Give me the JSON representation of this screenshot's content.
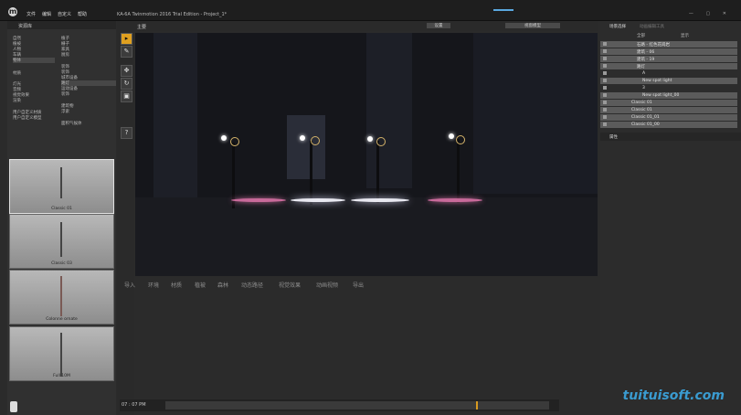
{
  "titlebar": {
    "menu": [
      "文件",
      "编辑",
      "自定义",
      "帮助"
    ],
    "app_title": "KA-6A Twinmotion 2016 Trial Edition - Project_1*"
  },
  "library": {
    "title": "资源库",
    "col1": [
      "自然",
      "植被",
      "人物",
      "车辆",
      "物体",
      "",
      "",
      "",
      "材质",
      "",
      "灯光",
      "音频",
      "视觉效果",
      "渲染",
      "",
      "用户自定义材质",
      "用户自定义模型"
    ],
    "col2": [
      "植子",
      "栅子",
      "家具",
      "厨房",
      "",
      "装饰",
      "装饰",
      "城市设备",
      "路灯",
      "运动设备",
      "装饰",
      "",
      "建筑物",
      "浮索",
      "",
      "面积气候体"
    ],
    "selected_col1": "物体",
    "selected_col2": "路灯",
    "items": [
      {
        "name": "Classic 01"
      },
      {
        "name": "Classic 03"
      },
      {
        "name": "Colonne ornate"
      },
      {
        "name": "Full 10M"
      }
    ]
  },
  "viewport": {
    "camera_label": "主要",
    "btn_left": "设置",
    "btn_right": "视窗模型"
  },
  "bottom_tabs": [
    "导入",
    "环境",
    "材质",
    "植被",
    "森林",
    "动态路径",
    "视觉效果",
    "动画视频",
    "导出"
  ],
  "timeline": {
    "time": "07 : 07  PM",
    "position": 0.81
  },
  "scene": {
    "tabs": [
      "场景选择",
      "动画编辑工具"
    ],
    "columns": [
      "全部",
      "显示"
    ],
    "rows": [
      {
        "label": "石路 - 红色花岗岩",
        "indent": 2,
        "selected": true
      },
      {
        "label": "建筑 - 06",
        "indent": 2,
        "selected": true
      },
      {
        "label": "建筑 - 19",
        "indent": 2,
        "selected": true
      },
      {
        "label": "路灯",
        "indent": 2,
        "selected": true
      },
      {
        "label": "A",
        "indent": 3,
        "selected": false
      },
      {
        "label": "New spot light",
        "indent": 3,
        "selected": true
      },
      {
        "label": "3",
        "indent": 3,
        "selected": false
      },
      {
        "label": "New spot light_00",
        "indent": 3,
        "selected": true
      },
      {
        "label": "Classic 01",
        "indent": 1,
        "selected": true
      },
      {
        "label": "Classic 01",
        "indent": 1,
        "selected": true
      },
      {
        "label": "Classic 01_01",
        "indent": 1,
        "selected": true
      },
      {
        "label": "Classic 01_00",
        "indent": 1,
        "selected": true
      }
    ],
    "properties_title": "属性"
  },
  "watermark": "tuituisoft.com",
  "colors": {
    "accent": "#e0a020",
    "selection": "#5b5b5b",
    "progress": "#5aa8e0"
  }
}
